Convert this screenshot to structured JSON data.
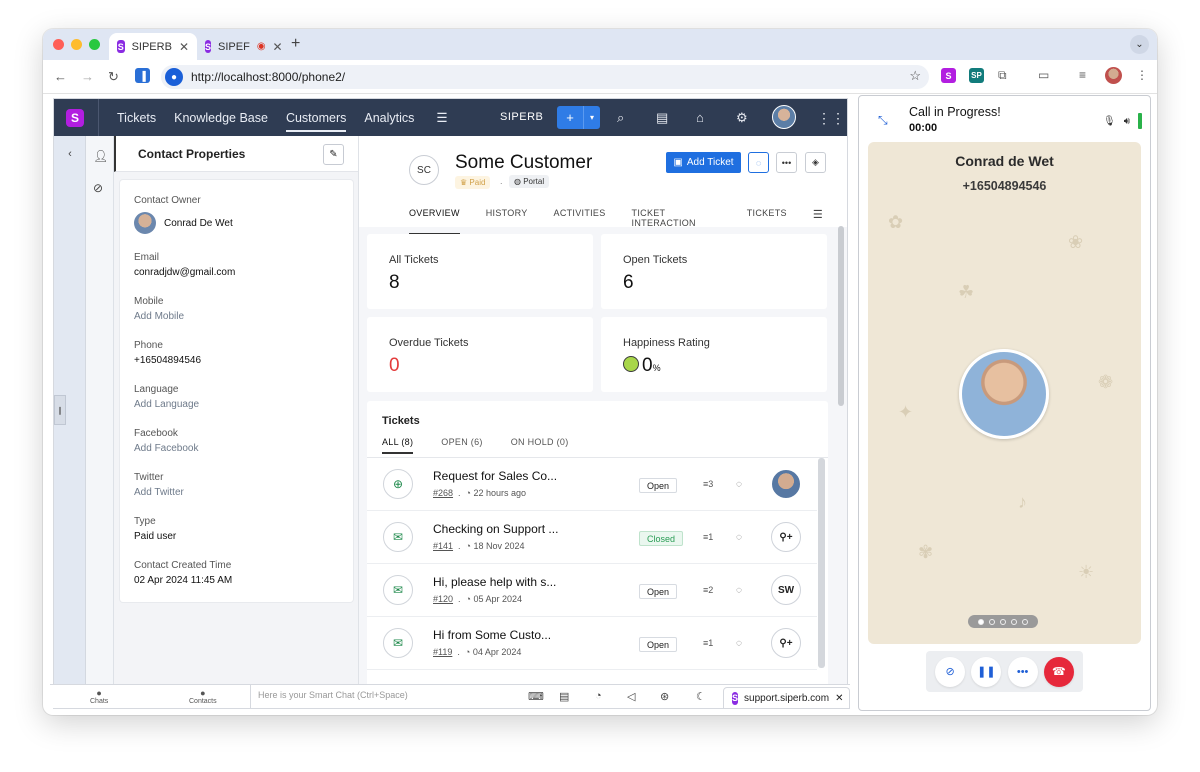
{
  "browser": {
    "tabs": [
      {
        "label": "SIPERB"
      },
      {
        "label": "SIPEF"
      }
    ],
    "url": "http://localhost:8000/phone2/"
  },
  "topnav": {
    "items": [
      "Tickets",
      "Knowledge Base",
      "Customers",
      "Analytics"
    ],
    "active": "Customers",
    "brand": "SIPERB"
  },
  "contact_panel": {
    "title": "Contact Properties",
    "owner_label": "Contact Owner",
    "owner_name": "Conrad De Wet",
    "fields": [
      {
        "label": "Email",
        "value": "conradjdw@gmail.com",
        "is_add": false
      },
      {
        "label": "Mobile",
        "value": "Add Mobile",
        "is_add": true
      },
      {
        "label": "Phone",
        "value": "+16504894546",
        "is_add": false
      },
      {
        "label": "Language",
        "value": "Add Language",
        "is_add": true
      },
      {
        "label": "Facebook",
        "value": "Add Facebook",
        "is_add": true
      },
      {
        "label": "Twitter",
        "value": "Add Twitter",
        "is_add": true
      },
      {
        "label": "Type",
        "value": "Paid user",
        "is_add": false
      },
      {
        "label": "Contact Created Time",
        "value": "02 Apr 2024 11:45 AM",
        "is_add": false
      }
    ]
  },
  "customer": {
    "initials": "SC",
    "name": "Some Customer",
    "paid_label": "Paid",
    "portal_label": "Portal",
    "add_ticket_label": "Add Ticket"
  },
  "tabs": [
    "OVERVIEW",
    "HISTORY",
    "ACTIVITIES",
    "TICKET INTERACTION",
    "TICKETS"
  ],
  "stats": {
    "all_label": "All Tickets",
    "all_value": "8",
    "open_label": "Open Tickets",
    "open_value": "6",
    "overdue_label": "Overdue Tickets",
    "overdue_value": "0",
    "happiness_label": "Happiness Rating",
    "happiness_value": "0",
    "happiness_unit": "%"
  },
  "tickets": {
    "title": "Tickets",
    "tabs": [
      "ALL (8)",
      "OPEN (6)",
      "ON HOLD (0)"
    ],
    "rows": [
      {
        "subject": "Request for Sales Co...",
        "num": "#268",
        "time": "22 hours ago",
        "status": "Open",
        "count": "3",
        "assignee": "",
        "icon": "web-icon"
      },
      {
        "subject": "Checking on Support ...",
        "num": "#141",
        "time": "18 Nov 2024",
        "status": "Closed",
        "count": "1",
        "assignee": "",
        "icon": "email-icon"
      },
      {
        "subject": "Hi, please help with s...",
        "num": "#120",
        "time": "05 Apr 2024",
        "status": "Open",
        "count": "2",
        "assignee": "SW",
        "icon": "email-icon"
      },
      {
        "subject": "Hi from Some Custo...",
        "num": "#119",
        "time": "04 Apr 2024",
        "status": "Open",
        "count": "1",
        "assignee": "",
        "icon": "email-icon"
      }
    ]
  },
  "bottombar": {
    "chats": "Chats",
    "contacts": "Contacts",
    "smartchat_placeholder": "Here is your Smart Chat (Ctrl+Space)",
    "site": "support.siperb.com"
  },
  "call": {
    "status": "Call in Progress!",
    "timer": "00:00",
    "caller_name": "Conrad de Wet",
    "caller_number": "+16504894546"
  },
  "colors": {
    "nav": "#2f3c53",
    "accent": "#1f6fe0",
    "end_call": "#e6283b",
    "overdue": "#e33b3b"
  }
}
